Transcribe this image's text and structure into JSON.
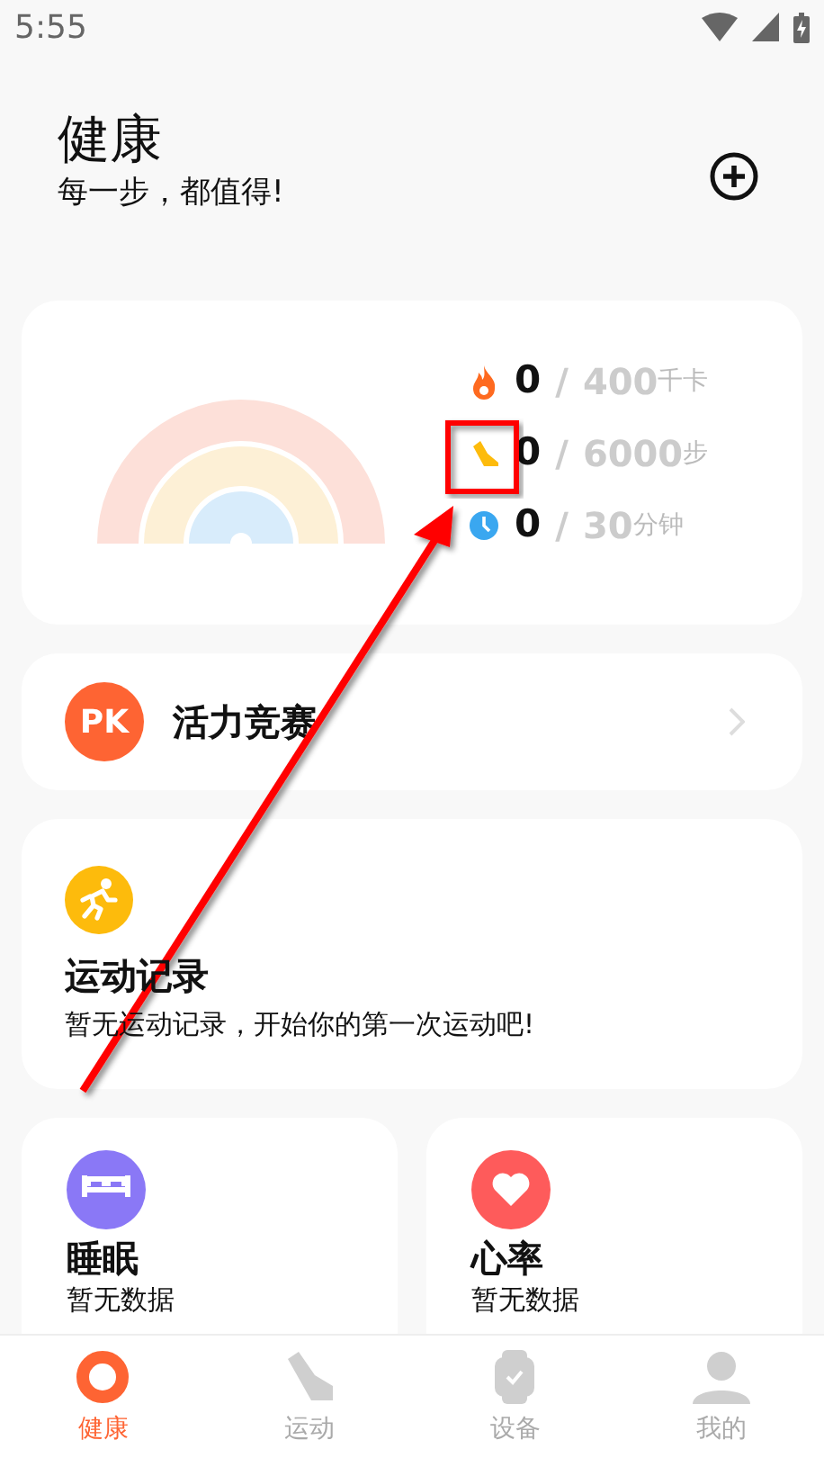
{
  "status_bar": {
    "time": "5:55"
  },
  "header": {
    "title": "健康",
    "subtitle": "每一步，都值得!"
  },
  "goals": [
    {
      "kind": "calories",
      "value": "0",
      "separator": "/",
      "target": "400",
      "unit": "千卡"
    },
    {
      "kind": "steps",
      "value": "0",
      "separator": "/",
      "target": "6000",
      "unit": "步"
    },
    {
      "kind": "duration",
      "value": "0",
      "separator": "/",
      "target": "30",
      "unit": "分钟"
    }
  ],
  "challenge": {
    "badge": "PK",
    "title": "活力竞赛"
  },
  "workout": {
    "title": "运动记录",
    "subtitle": "暂无运动记录，开始你的第一次运动吧!"
  },
  "tiles": [
    {
      "kind": "sleep",
      "title": "睡眠",
      "subtitle": "暂无数据"
    },
    {
      "kind": "heart",
      "title": "心率",
      "subtitle": "暂无数据"
    }
  ],
  "nav": [
    {
      "kind": "health",
      "label": "健康",
      "selected": true
    },
    {
      "kind": "sport",
      "label": "运动",
      "selected": false
    },
    {
      "kind": "device",
      "label": "设备",
      "selected": false
    },
    {
      "kind": "me",
      "label": "我的",
      "selected": false
    }
  ]
}
